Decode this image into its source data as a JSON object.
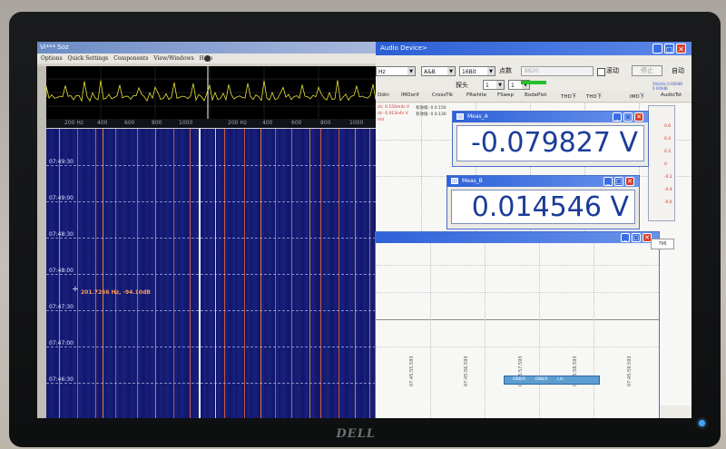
{
  "left_app": {
    "title": "Vi*** Soz",
    "menu": [
      "Options",
      "Quick Settings",
      "Components",
      "View/Windows",
      "Help"
    ],
    "freq_labels_1": [
      "200 Hz",
      "400",
      "600",
      "800",
      "1000"
    ],
    "freq_labels_2": [
      "200 Hz",
      "400",
      "600",
      "800",
      "1000"
    ],
    "time_labels": [
      "07:49:30",
      "07:49:00",
      "07:48:30",
      "07:48:00",
      "07:47:30",
      "07:47:00",
      "07:46:30"
    ],
    "marker_text": "201.7266 Hz, -94.10dB"
  },
  "right_app": {
    "title": "Audio Device>",
    "toolbar": {
      "rate_select": "Hz",
      "channel_select": "A&B",
      "bits_select": "16Bit",
      "points_label": "点数",
      "points_value": "8820",
      "auto_scroll_label": "滚动",
      "stop_label": "停止",
      "auto_label": "自动",
      "probe_label": "探头",
      "probe_a": "1",
      "probe_b": "1"
    },
    "info_text": [
      "5Hz/div 0.000dB",
      "0.000dB",
      "Hz/div 0.000dB"
    ],
    "tabs": [
      "Odin",
      "IMDorif",
      "CrossTlk",
      "FRwhite",
      "FSwep",
      "BodePlot",
      "THD下",
      "THD下",
      "IMD下",
      "AudioTst"
    ],
    "mini_text": [
      "sh: 0.150m4s  V  ",
      "有效值: 0 0.150",
      "dc: 0.013n4s  V  ",
      "有效值: 0 0.130",
      "  mV"
    ],
    "meter_a": {
      "title": "Meas_A",
      "value": "-0.079827 V"
    },
    "meter_b": {
      "title": "Meas_B",
      "value": "0.014546 V"
    },
    "side_values": [
      "0.6",
      "0.4",
      "0.2",
      "0",
      "-0.2",
      "-0.4",
      "-0.6"
    ],
    "side_box": "?96",
    "legend": [
      "OBB/S",
      "OBB/S",
      "Lin"
    ],
    "x_times": [
      "07:45:55.593",
      "07:45:56.593",
      "07:45:57.593",
      "07:45:58.593",
      "07:45:59.593"
    ]
  },
  "monitor": {
    "brand": "DELL"
  },
  "colors": {
    "waterfall": "#131869",
    "trace": "#e8e23a",
    "meter_text": "#1b3c98",
    "title_bar": "#2c5fd4"
  }
}
